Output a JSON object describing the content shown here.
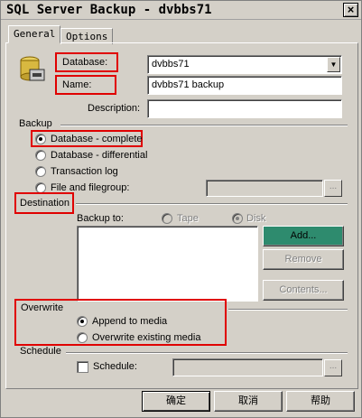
{
  "window": {
    "title": "SQL Server Backup - dvbbs71",
    "close_glyph": "×"
  },
  "tabs": [
    {
      "label": "General"
    },
    {
      "label": "Options"
    }
  ],
  "general": {
    "database_label": "Database:",
    "database_value": "dvbbs71",
    "name_label": "Name:",
    "name_value": "dvbbs71 backup",
    "description_label": "Description:",
    "description_value": ""
  },
  "backup": {
    "group_label": "Backup",
    "options": [
      {
        "label": "Database - complete",
        "checked": true
      },
      {
        "label": "Database - differential",
        "checked": false
      },
      {
        "label": "Transaction log",
        "checked": false
      },
      {
        "label": "File and filegroup:",
        "checked": false
      }
    ],
    "file_browse_label": "..."
  },
  "destination": {
    "group_label": "Destination",
    "backup_to_label": "Backup to:",
    "tape_label": "Tape",
    "disk_label": "Disk",
    "add_label": "Add...",
    "remove_label": "Remove",
    "contents_label": "Contents..."
  },
  "overwrite": {
    "group_label": "Overwrite",
    "append_label": "Append to media",
    "overwrite_label": "Overwrite existing media"
  },
  "schedule": {
    "group_label": "Schedule",
    "checkbox_label": "Schedule:",
    "browse_label": "..."
  },
  "footer": {
    "ok_label": "确定",
    "cancel_label": "取消",
    "help_label": "帮助"
  },
  "colors": {
    "highlight_box": "#e00000",
    "add_button": "#2e8b6e"
  }
}
